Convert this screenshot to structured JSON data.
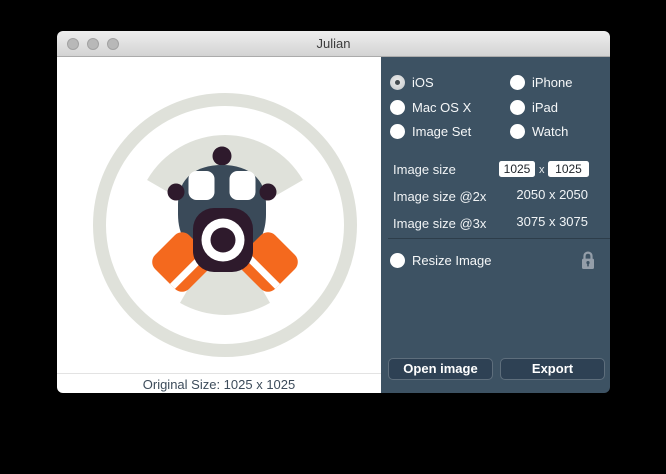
{
  "window": {
    "title": "Julian"
  },
  "preview": {
    "caption": "Original Size: 1025 x 1025"
  },
  "platforms": {
    "options": [
      {
        "label": "iOS",
        "selected": true
      },
      {
        "label": "iPhone",
        "selected": false
      },
      {
        "label": "Mac OS X",
        "selected": false
      },
      {
        "label": "iPad",
        "selected": false
      },
      {
        "label": "Image Set",
        "selected": false
      },
      {
        "label": "Watch",
        "selected": false
      }
    ]
  },
  "size_section": {
    "image_size_label": "Image size",
    "width_value": "1025",
    "separator": "x",
    "height_value": "1025",
    "size_2x_label": "Image size @2x",
    "size_2x_value": "2050 x 2050",
    "size_3x_label": "Image size @3x",
    "size_3x_value": "3075 x 3075"
  },
  "resize": {
    "label": "Resize Image",
    "locked": true,
    "lock_icon": "lock-closed"
  },
  "actions": {
    "open_label": "Open image",
    "export_label": "Export"
  },
  "colors": {
    "panel_bg": "#3d5263",
    "accent_orange": "#f4691e",
    "mask_slate": "#3a4a59",
    "mask_maroon": "#2e1a2c",
    "trefoil_gray": "#dfe1da"
  }
}
